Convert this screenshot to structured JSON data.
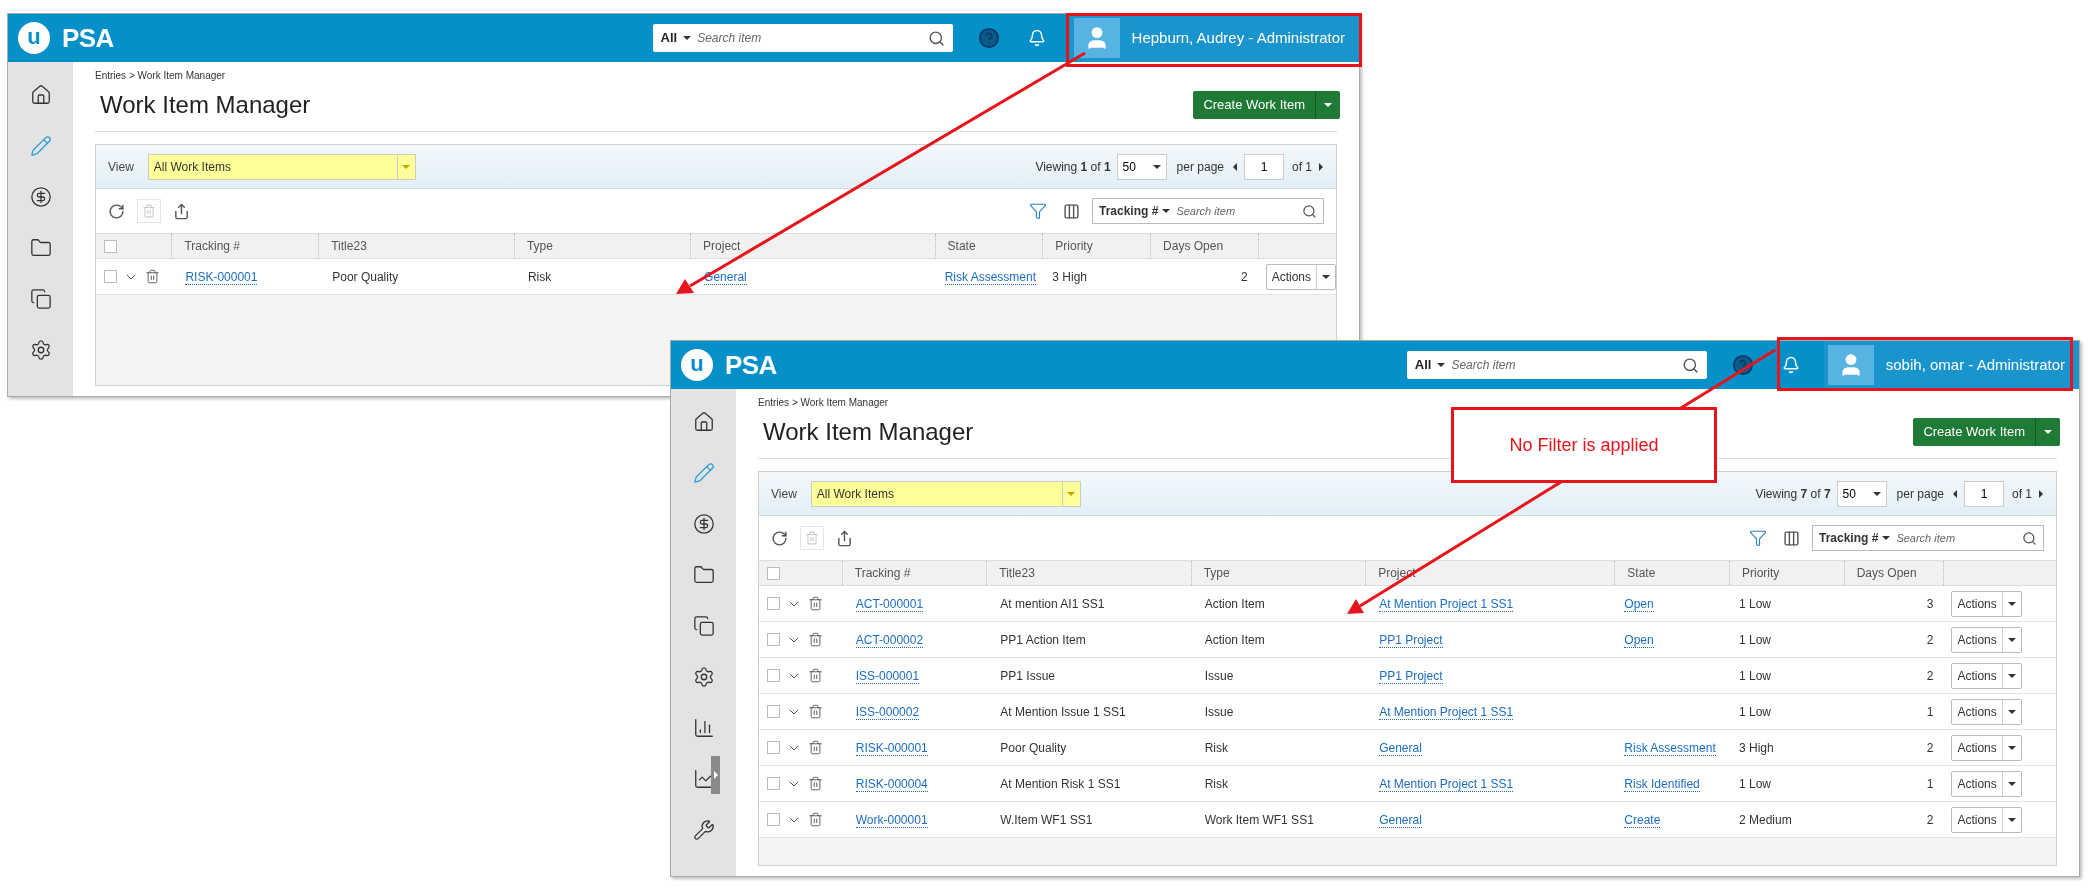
{
  "windows": [
    {
      "header": {
        "logo_mark": "u",
        "logo": "PSA",
        "search_scope": "All",
        "search_placeholder": "Search item",
        "user": "Hepburn, Audrey - Administrator"
      },
      "sidebar": [
        {
          "selected": false
        },
        {
          "selected": true
        },
        {
          "selected": false
        },
        {
          "selected": false
        },
        {
          "selected": false
        },
        {
          "selected": false
        }
      ],
      "select_all_checked": false,
      "breadcrumb": "Entries > Work Item Manager",
      "title": "Work Item Manager",
      "create_button": "Create Work Item",
      "view": {
        "label": "View",
        "value": "All Work Items"
      },
      "paging": {
        "viewing": "Viewing",
        "shown": "1",
        "of": "of",
        "total": "1",
        "per_page_value": "50",
        "per_page_label": "per page",
        "page": "1",
        "page_of": "of 1"
      },
      "search": {
        "scope": "Tracking #",
        "placeholder": "Search item"
      },
      "columns": [
        "Tracking #",
        "Title23",
        "Type",
        "Project",
        "State",
        "Priority",
        "Days Open"
      ],
      "rows": [
        {
          "checked": false,
          "tracking": "RISK-000001",
          "title": "Poor Quality",
          "type": "Risk",
          "project": "General",
          "state": "Risk Assessment",
          "priority": "3 High",
          "days_open": "2",
          "action": "Actions"
        }
      ]
    },
    {
      "header": {
        "logo_mark": "u",
        "logo": "PSA",
        "search_scope": "All",
        "search_placeholder": "Search item",
        "user": "sobih, omar - Administrator"
      },
      "sidebar": [
        {
          "selected": false
        },
        {
          "selected": true
        },
        {
          "selected": false
        },
        {
          "selected": false
        },
        {
          "selected": false
        },
        {
          "selected": false
        },
        {
          "selected": false
        },
        {
          "selected": false
        },
        {
          "selected": false
        }
      ],
      "select_all_checked": false,
      "breadcrumb": "Entries > Work Item Manager",
      "title": "Work Item Manager",
      "create_button": "Create Work Item",
      "view": {
        "label": "View",
        "value": "All Work Items"
      },
      "paging": {
        "viewing": "Viewing",
        "shown": "7",
        "of": "of",
        "total": "7",
        "per_page_value": "50",
        "per_page_label": "per page",
        "page": "1",
        "page_of": "of 1"
      },
      "search": {
        "scope": "Tracking #",
        "placeholder": "Search item"
      },
      "columns": [
        "Tracking #",
        "Title23",
        "Type",
        "Project",
        "State",
        "Priority",
        "Days Open"
      ],
      "rows": [
        {
          "checked": false,
          "tracking": "ACT-000001",
          "title": "At mention AI1 SS1",
          "type": "Action Item",
          "project": "At Mention Project 1 SS1",
          "state": "Open",
          "priority": "1 Low",
          "days_open": "3",
          "action": "Actions"
        },
        {
          "checked": false,
          "tracking": "ACT-000002",
          "title": "PP1 Action Item",
          "type": "Action Item",
          "project": "PP1 Project",
          "state": "Open",
          "priority": "1 Low",
          "days_open": "2",
          "action": "Actions"
        },
        {
          "checked": false,
          "tracking": "ISS-000001",
          "title": "PP1 Issue",
          "type": "Issue",
          "project": "PP1 Project",
          "priority": "1 Low",
          "days_open": "2",
          "action": "Actions"
        },
        {
          "checked": false,
          "tracking": "ISS-000002",
          "title": "At Mention Issue 1 SS1",
          "type": "Issue",
          "project": "At Mention Project 1 SS1",
          "priority": "1 Low",
          "days_open": "1",
          "action": "Actions"
        },
        {
          "checked": false,
          "tracking": "RISK-000001",
          "title": "Poor Quality",
          "type": "Risk",
          "project": "General",
          "state": "Risk Assessment",
          "priority": "3 High",
          "days_open": "2",
          "action": "Actions"
        },
        {
          "checked": false,
          "tracking": "RISK-000004",
          "title": "At Mention Risk 1 SS1",
          "type": "Risk",
          "project": "At Mention Project 1 SS1",
          "state": "Risk Identified",
          "priority": "1 Low",
          "days_open": "1",
          "action": "Actions"
        },
        {
          "checked": false,
          "tracking": "Work-000001",
          "title": "W.Item WF1 SS1",
          "type": "Work Item WF1 SS1",
          "project": "General",
          "state": "Create",
          "priority": "2 Medium",
          "days_open": "2",
          "action": "Actions"
        }
      ]
    }
  ],
  "annotation": {
    "text": "No Filter is applied"
  }
}
